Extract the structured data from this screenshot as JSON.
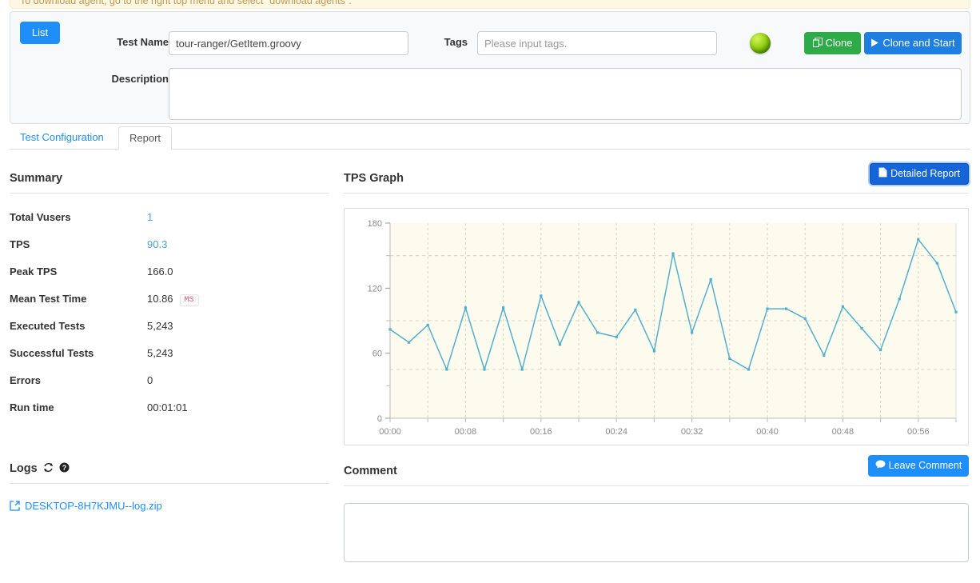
{
  "banner": {
    "text": "To download agent, go to the right top menu and select \"download agents\"."
  },
  "header": {
    "list_button": "List",
    "test_name_label": "Test Name",
    "test_name_value": "tour-ranger/GetItem.groovy",
    "tags_label": "Tags",
    "tags_value": "",
    "tags_placeholder": "Please input tags.",
    "description_label": "Description",
    "description_value": "",
    "status_icon": "green-status-ball",
    "clone_button": "Clone",
    "clone_icon": "copy-icon",
    "clone_and_start_button": "Clone and Start",
    "clone_and_start_icon": "play-icon"
  },
  "tabs": [
    {
      "label": "Test Configuration",
      "active": false
    },
    {
      "label": "Report",
      "active": true
    }
  ],
  "summary": {
    "title": "Summary",
    "rows": [
      {
        "key": "Total Vusers",
        "value": "1",
        "link": true
      },
      {
        "key": "TPS",
        "value": "90.3",
        "link": true
      },
      {
        "key": "Peak TPS",
        "value": "166.0",
        "link": false
      },
      {
        "key": "Mean Test Time",
        "value": "10.86",
        "link": false,
        "badge": "MS"
      },
      {
        "key": "Executed Tests",
        "value": "5,243",
        "link": false
      },
      {
        "key": "Successful Tests",
        "value": "5,243",
        "link": false
      },
      {
        "key": "Errors",
        "value": "0",
        "link": false
      },
      {
        "key": "Run time",
        "value": "00:01:01",
        "link": false
      }
    ]
  },
  "logs": {
    "title": "Logs",
    "refresh_icon": "refresh-icon",
    "help_icon": "question-circle-icon",
    "files": [
      {
        "name": "DESKTOP-8H7KJMU--log.zip",
        "icon": "external-link-icon"
      }
    ]
  },
  "tps_graph": {
    "title": "TPS Graph",
    "detailed_report_button": "Detailed Report",
    "detailed_report_icon": "document-icon"
  },
  "comment": {
    "title": "Comment",
    "leave_comment_button": "Leave Comment",
    "leave_comment_icon": "speech-bubble-icon",
    "value": "",
    "placeholder": ""
  },
  "colors": {
    "primary_blue": "#1e8ffa",
    "clone_green": "#2faa48",
    "detailed_blue": "#1565d8",
    "chart_line": "#53b0cc",
    "chart_bg": "#fdfaee",
    "link_blue": "#4e9fd1",
    "badge_red": "#e8556d",
    "banner_bg": "#fcf8e3"
  },
  "chart_data": {
    "type": "line",
    "title": "TPS Graph",
    "xlabel": "",
    "ylabel": "",
    "ylim": [
      0,
      180
    ],
    "yticks": [
      0,
      60,
      120,
      180
    ],
    "yminor": [
      30,
      90,
      150
    ],
    "gridlines_y": [
      45,
      90,
      150
    ],
    "grid": true,
    "legend": "none",
    "xtick_labels": [
      "00:00",
      "00:08",
      "00:16",
      "00:24",
      "00:32",
      "00:40",
      "00:48",
      "00:56"
    ],
    "xtick_interval_seconds": 8,
    "point_interval_seconds": 2,
    "xlim_seconds": [
      0,
      60
    ],
    "series": [
      {
        "name": "TPS",
        "color": "#53b0cc",
        "x": [
          0,
          2,
          4,
          6,
          8,
          10,
          12,
          14,
          16,
          18,
          20,
          22,
          24,
          26,
          28,
          30,
          32,
          34,
          36,
          38,
          40,
          42,
          44,
          46,
          48,
          50,
          52,
          54,
          56,
          58,
          60
        ],
        "values": [
          82,
          70,
          86,
          45,
          102,
          45,
          102,
          45,
          113,
          68,
          107,
          79,
          75,
          100,
          62,
          152,
          79,
          128,
          55,
          45,
          101,
          101,
          92,
          58,
          103,
          83,
          63,
          110,
          165,
          143,
          98
        ]
      }
    ]
  }
}
